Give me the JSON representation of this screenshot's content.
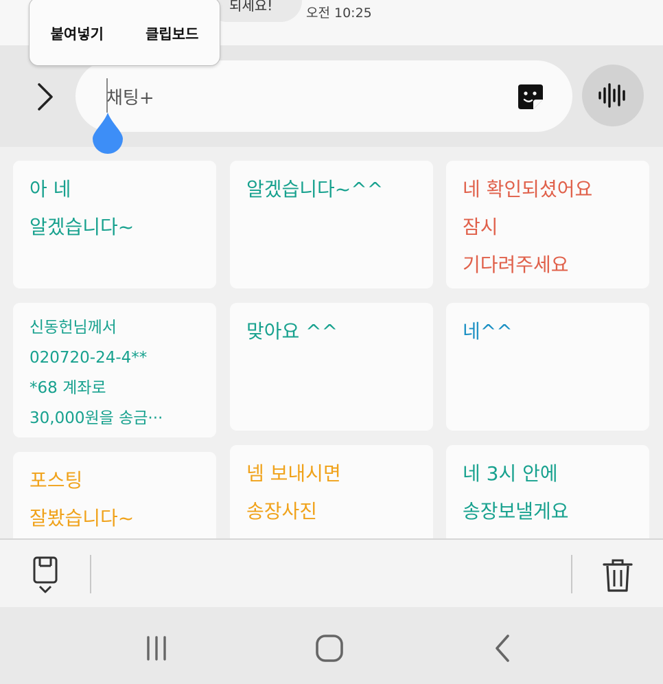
{
  "chat": {
    "previous_message_fragment": "되세요!",
    "timestamp": "오전 10:25"
  },
  "paste_popup": {
    "paste_label": "붙여넣기",
    "clipboard_label": "클립보드"
  },
  "input": {
    "value": "채팅+"
  },
  "clipboard_items": [
    {
      "text": "아 네\n알겠습니다~",
      "color": "#17a18e"
    },
    {
      "text": "알겠습니다~^^",
      "color": "#17a18e"
    },
    {
      "text": "네 확인되셨어요\n잠시\n기다려주세요",
      "color": "#e0604a"
    },
    {
      "text": "신동헌님께서\n020720-24-4**\n*68 계좌로\n30,000원을 송금···",
      "color": "#17a18e"
    },
    {
      "text": "맞아요 ^^",
      "color": "#17a18e"
    },
    {
      "text": "네^^",
      "color": "#1a8fc3"
    },
    {
      "text": "포스팅\n잘봤습니다~",
      "color": "#f0a21a"
    },
    {
      "text": "넴 보내시면\n송장사진\n보내드릴게요^^",
      "color": "#f0a21a"
    },
    {
      "text": "네 3시 안에\n송장보낼게요",
      "color": "#17a18e"
    }
  ],
  "icons": {
    "expand": "chevron-right-icon",
    "sticker": "sticker-icon",
    "voice": "voice-wave-icon",
    "paste": "paste-icon",
    "trash": "trash-icon",
    "recents": "recents-icon",
    "home": "home-icon",
    "back": "back-icon"
  }
}
